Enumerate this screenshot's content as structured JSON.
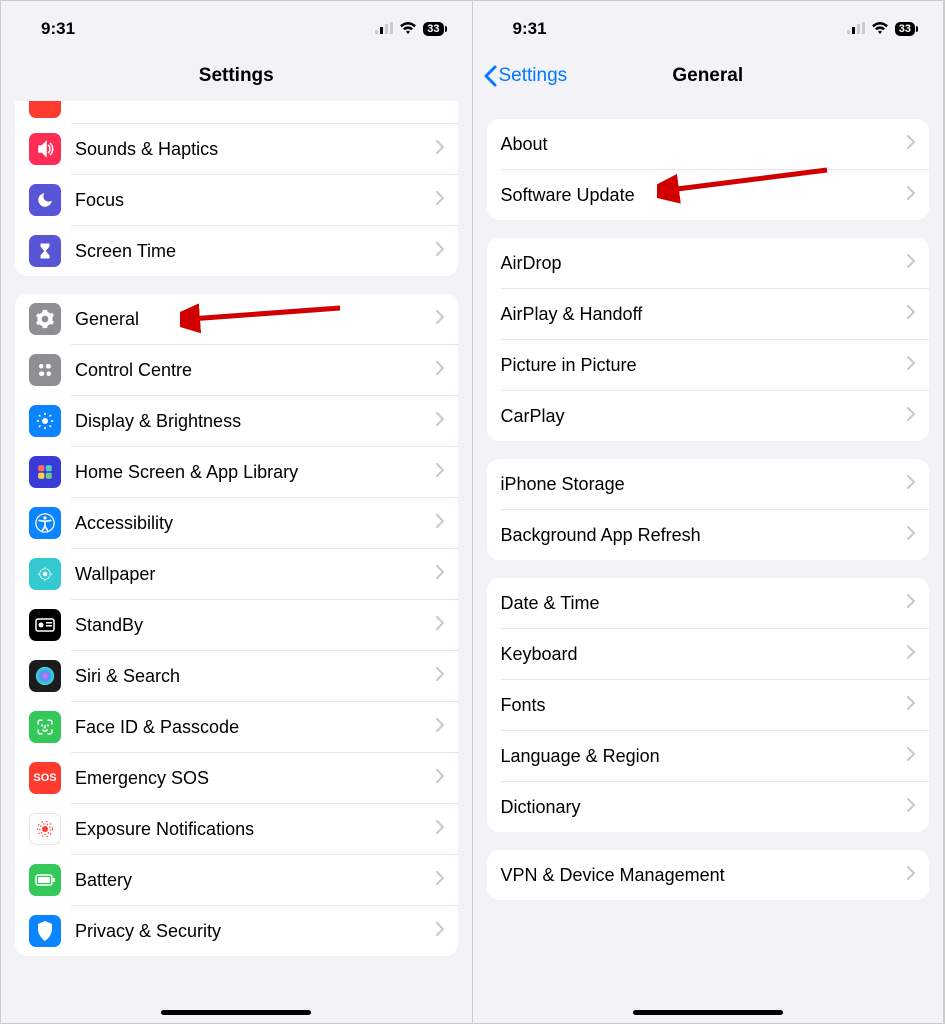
{
  "statusbar": {
    "time": "9:31",
    "battery": "33"
  },
  "left": {
    "title": "Settings",
    "group0": {
      "sounds": "Sounds & Haptics",
      "focus": "Focus",
      "screentime": "Screen Time"
    },
    "group1": {
      "general": "General",
      "control": "Control Centre",
      "display": "Display & Brightness",
      "home": "Home Screen & App Library",
      "accessibility": "Accessibility",
      "wallpaper": "Wallpaper",
      "standby": "StandBy",
      "siri": "Siri & Search",
      "faceid": "Face ID & Passcode",
      "sos": "Emergency SOS",
      "exposure": "Exposure Notifications",
      "battery": "Battery",
      "privacy": "Privacy & Security"
    }
  },
  "right": {
    "back": "Settings",
    "title": "General",
    "g0": {
      "about": "About",
      "software": "Software Update"
    },
    "g1": {
      "airdrop": "AirDrop",
      "airplay": "AirPlay & Handoff",
      "pip": "Picture in Picture",
      "carplay": "CarPlay"
    },
    "g2": {
      "storage": "iPhone Storage",
      "refresh": "Background App Refresh"
    },
    "g3": {
      "datetime": "Date & Time",
      "keyboard": "Keyboard",
      "fonts": "Fonts",
      "lang": "Language & Region",
      "dict": "Dictionary"
    },
    "g4": {
      "vpn": "VPN & Device Management"
    }
  },
  "icons": {
    "sounds_bg": "#ff2d55",
    "focus_bg": "#5856d6",
    "screentime_bg": "#5856d6",
    "general_bg": "#8e8e93",
    "control_bg": "#8e8e93",
    "display_bg": "#0a84ff",
    "home_bg": "#4a4aff",
    "accessibility_bg": "#0a84ff",
    "wallpaper_bg": "#34c8d1",
    "standby_bg": "#000000",
    "siri_bg": "#1c1c1e",
    "faceid_bg": "#34c759",
    "sos_bg": "#ff3b30",
    "exposure_bg": "#ffffff",
    "battery_bg": "#34c759",
    "privacy_bg": "#0a84ff"
  }
}
